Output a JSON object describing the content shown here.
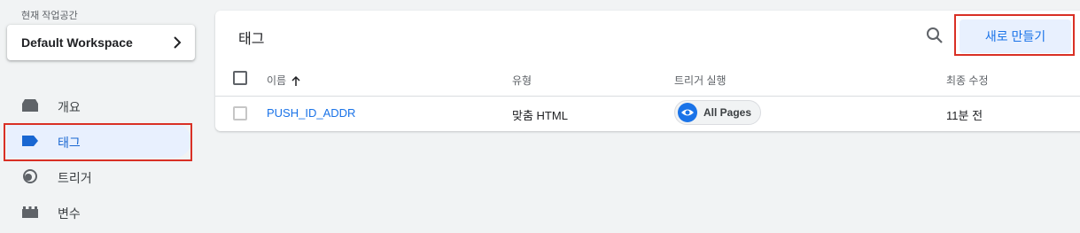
{
  "workspace": {
    "label": "현재 작업공간",
    "name": "Default Workspace"
  },
  "nav": {
    "items": [
      {
        "label": "개요",
        "icon": "overview-icon"
      },
      {
        "label": "태그",
        "icon": "tag-icon",
        "active": true
      },
      {
        "label": "트리거",
        "icon": "trigger-icon"
      },
      {
        "label": "변수",
        "icon": "variables-icon"
      }
    ]
  },
  "panel": {
    "title": "태그",
    "new_button_label": "새로 만들기"
  },
  "table": {
    "columns": [
      "이름",
      "유형",
      "트리거 실행",
      "최종 수정"
    ],
    "rows": [
      {
        "name": "PUSH_ID_ADDR",
        "type": "맞춤 HTML",
        "trigger": "All Pages",
        "modified": "11분 전"
      }
    ]
  },
  "colors": {
    "accent": "#1a73e8",
    "active_bg": "#e8f0fe",
    "highlight_box": "#d93025"
  }
}
